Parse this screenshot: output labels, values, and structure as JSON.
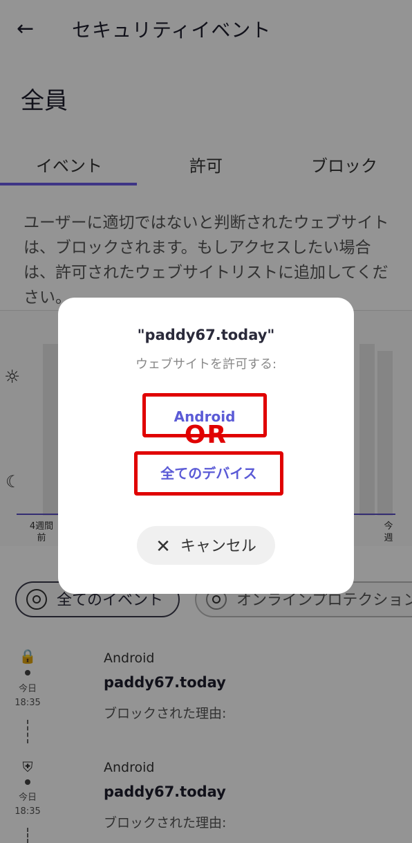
{
  "header": {
    "title": "セキュリティイベント",
    "back_icon": "←"
  },
  "group_name": "全員",
  "tabs": [
    {
      "label": "イベント",
      "selected": true
    },
    {
      "label": "許可",
      "selected": false
    },
    {
      "label": "ブロック",
      "selected": false
    }
  ],
  "description": "ユーザーに適切ではないと判断されたウェブサイトは、ブロックされます。もしアクセスしたい場合は、許可されたウェブサイトリストに追加してください。",
  "chart": {
    "x_start": {
      "line1": "4週間",
      "line2": "前"
    },
    "x_end": {
      "line1": "今",
      "line2": "週"
    },
    "sun_icon": "☼",
    "moon_icon": "☾"
  },
  "filters": {
    "all_events": "全てのイベント",
    "online_protection": "オンラインプロテクション"
  },
  "events": [
    {
      "time_day": "今日",
      "time": "18:35",
      "device": "Android",
      "site": "paddy67.today",
      "reason": "ブロックされた理由:",
      "icon": "lock-icon"
    },
    {
      "time_day": "今日",
      "time": "18:35",
      "device": "Android",
      "site": "paddy67.today",
      "reason": "ブロックされた理由:",
      "icon": "shield-icon"
    }
  ],
  "dialog": {
    "title": "\"paddy67.today\"",
    "subtitle": "ウェブサイトを許可する:",
    "option_android": "Android",
    "or_label": "OR",
    "option_all_devices": "全てのデバイス",
    "cancel_label": "キャンセル",
    "cancel_icon": "✕"
  },
  "colors": {
    "accent": "#6c5ce7",
    "annotation_red": "#e00000",
    "link": "#5b5bd6"
  }
}
